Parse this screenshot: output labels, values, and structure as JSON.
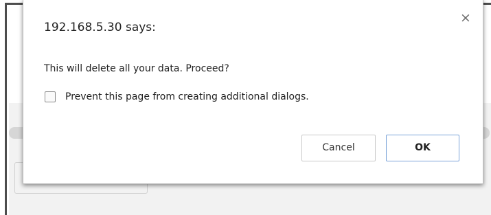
{
  "dialog": {
    "title": "192.168.5.30 says:",
    "message": "This will delete all your data. Proceed?",
    "checkbox_label": "Prevent this page from creating additional dialogs.",
    "checkbox_checked": false,
    "close_glyph": "×",
    "cancel_label": "Cancel",
    "ok_label": "OK"
  },
  "colors": {
    "ok_border": "#7aa3d9",
    "window_border": "#4d4d4d"
  }
}
